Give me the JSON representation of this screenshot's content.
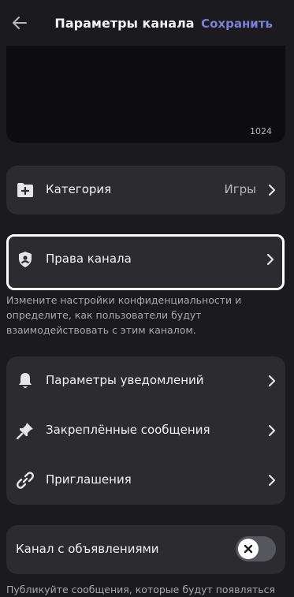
{
  "header": {
    "title": "Параметры канала",
    "save_label": "Сохранить"
  },
  "topic": {
    "char_count": "1024"
  },
  "category": {
    "label": "Категория",
    "value": "Игры"
  },
  "permissions": {
    "label": "Права канала",
    "description": "Измените настройки конфиденциальности и определите, как пользователи будут взаимодействовать с этим каналом."
  },
  "settings_group": {
    "items": [
      {
        "label": "Параметры уведомлений",
        "icon": "bell-icon"
      },
      {
        "label": "Закреплённые сообщения",
        "icon": "pin-icon"
      },
      {
        "label": "Приглашения",
        "icon": "link-icon"
      }
    ]
  },
  "announcement": {
    "label": "Канал с объявлениями",
    "enabled": false,
    "description_partial": "Публикуйте сообщения, которые будут появляться"
  },
  "colors": {
    "background": "#1b1b1f",
    "card": "#2b2b30",
    "accent": "#7b7fd6",
    "text_primary": "#f2f3f5",
    "text_secondary": "#b5b8bf"
  }
}
